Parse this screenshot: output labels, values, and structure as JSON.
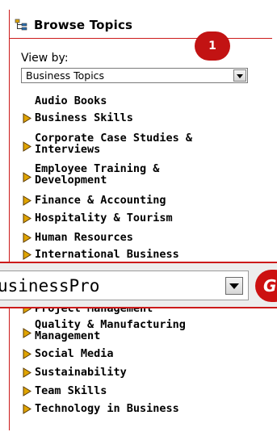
{
  "colors": {
    "accent": "#cc1a1a",
    "bullet": "#e0a400"
  },
  "header": {
    "title": "Browse Topics",
    "icon": "sitemap-icon"
  },
  "badge": {
    "label": "1"
  },
  "view_by": {
    "label": "View by:",
    "selected": "Business Topics"
  },
  "topics": [
    {
      "label": "Audio Books",
      "bullet": false
    },
    {
      "label": "Business Skills",
      "bullet": true
    },
    {
      "label": "Corporate Case Studies &\nInterviews",
      "bullet": true
    },
    {
      "label": "Employee Training &\nDevelopment",
      "bullet": true
    },
    {
      "label": "Finance & Accounting",
      "bullet": true
    },
    {
      "label": "Hospitality & Tourism",
      "bullet": true
    },
    {
      "label": "Human Resources",
      "bullet": true
    },
    {
      "label": "International Business",
      "bullet": true
    },
    {
      "label": "Project Management",
      "bullet": true
    },
    {
      "label": "Quality & Manufacturing\nManagement",
      "bullet": true
    },
    {
      "label": "Social Media",
      "bullet": true
    },
    {
      "label": "Sustainability",
      "bullet": true
    },
    {
      "label": "Team Skills",
      "bullet": true
    },
    {
      "label": "Technology in Business",
      "bullet": true
    }
  ],
  "overlay": {
    "selected": "usinessPro",
    "go_label": "GO"
  }
}
